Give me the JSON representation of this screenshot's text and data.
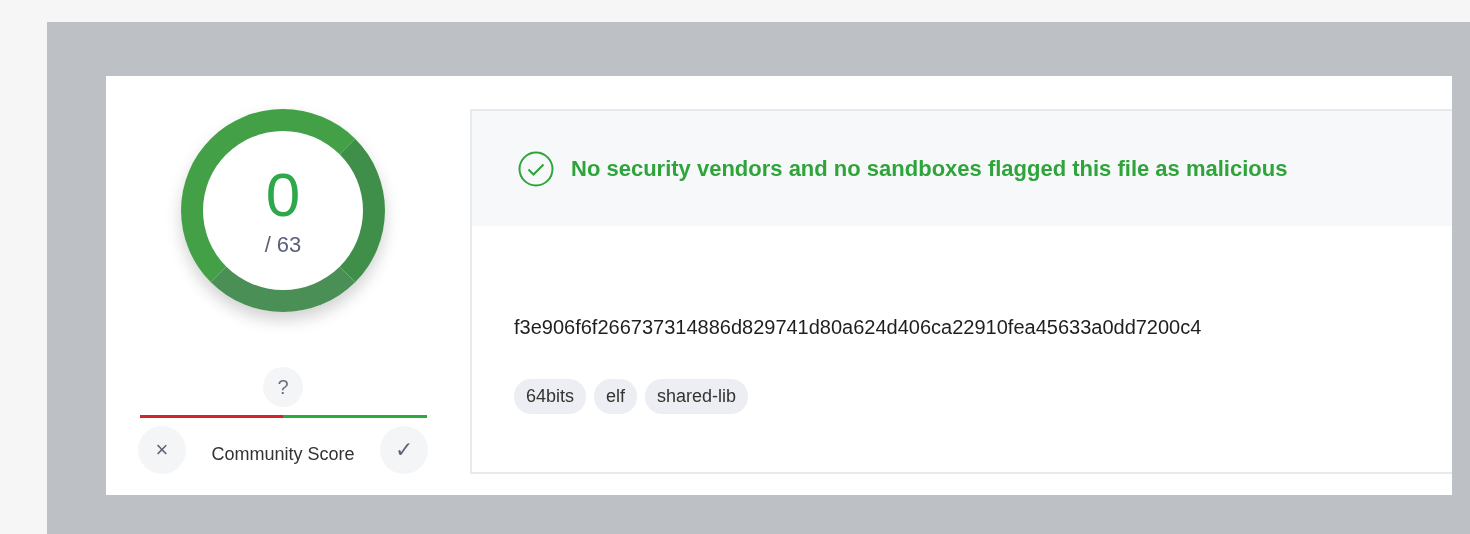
{
  "detections": {
    "count": "0",
    "total": "/ 63"
  },
  "community": {
    "unknown_marker": "?",
    "level": 0.5,
    "label": "Community Score",
    "remove_glyph": "×",
    "confirm_glyph": "✓"
  },
  "verdict": {
    "message": "No security vendors and no sandboxes flagged this file as malicious"
  },
  "file": {
    "hash": "f3e906f6f266737314886d829741d80a624d406ca22910fea45633a0dd7200c4",
    "tags": [
      "64bits",
      "elf",
      "shared-lib"
    ]
  }
}
